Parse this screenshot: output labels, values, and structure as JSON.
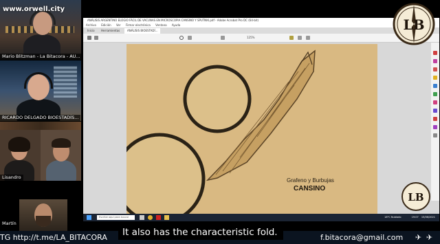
{
  "watermark": "www.orwell.city",
  "participants": [
    {
      "name": "Mario Blitzman - La Bitacora - AU..."
    },
    {
      "name": "RICARDO DELGADO BIOESTADÍS..."
    },
    {
      "name": "Lisandro"
    },
    {
      "name": "Martín"
    }
  ],
  "pdf_window": {
    "title": "ANÁLISIS ARGENTINO ELOGIO FÁCIL DE VACUNAS EN MICROSCOPIA CANSINO Y SPUTNIK.pdf - Adobe Acrobat Pro DC (64-bit)",
    "menu": [
      "Archivo",
      "Edición",
      "Ver",
      "Firmar electrónica",
      "Ventana",
      "Ayuda"
    ],
    "tabs": [
      "Inicio",
      "Herramientas",
      "ANÁLISIS BIOESTADÍ..."
    ],
    "zoom": "125%",
    "page_label": "Grafeno y Burbujas",
    "page_label2": "CANSINO"
  },
  "taskbar": {
    "search_placeholder": "Escribe aquí para buscar",
    "weather": "18°C Nublado",
    "time": "19:07",
    "date": "15/06/2021"
  },
  "logo_text": "LB",
  "subtitle": "It also has the characteristic fold.",
  "ticker_left": "TG http://t.me/LA_BITACORA",
  "ticker_right": "f.bitacora@gmail.com",
  "colors": {
    "slide_bg": "#d9b982",
    "taskbar": "#1b2433",
    "ticker": "#0b1420"
  }
}
